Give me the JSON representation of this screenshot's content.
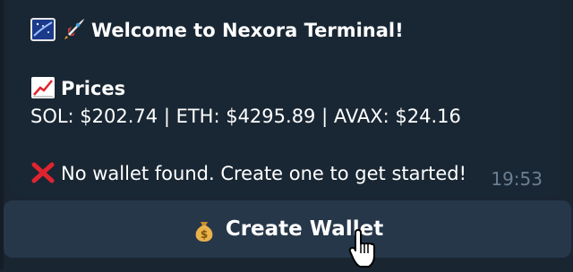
{
  "message": {
    "welcome_title": "Welcome to Nexora Terminal!",
    "prices_heading": "Prices",
    "prices_line": "SOL: $202.74 | ETH: $4295.89 | AVAX: $24.16",
    "wallet_notice": "No wallet found. Create one to get started!",
    "time": "19:53"
  },
  "keyboard": {
    "create_wallet_label": "Create Wallet"
  },
  "colors": {
    "background": "#1a2532",
    "bubble": "#192734",
    "button": "#26374a",
    "timestamp": "#6c7f92",
    "error_red": "#e0242f"
  },
  "icons": [
    "night-sky-icon",
    "rocket-icon",
    "chart-increasing-icon",
    "cross-mark-icon",
    "money-bag-icon",
    "hand-pointer-cursor-icon"
  ]
}
